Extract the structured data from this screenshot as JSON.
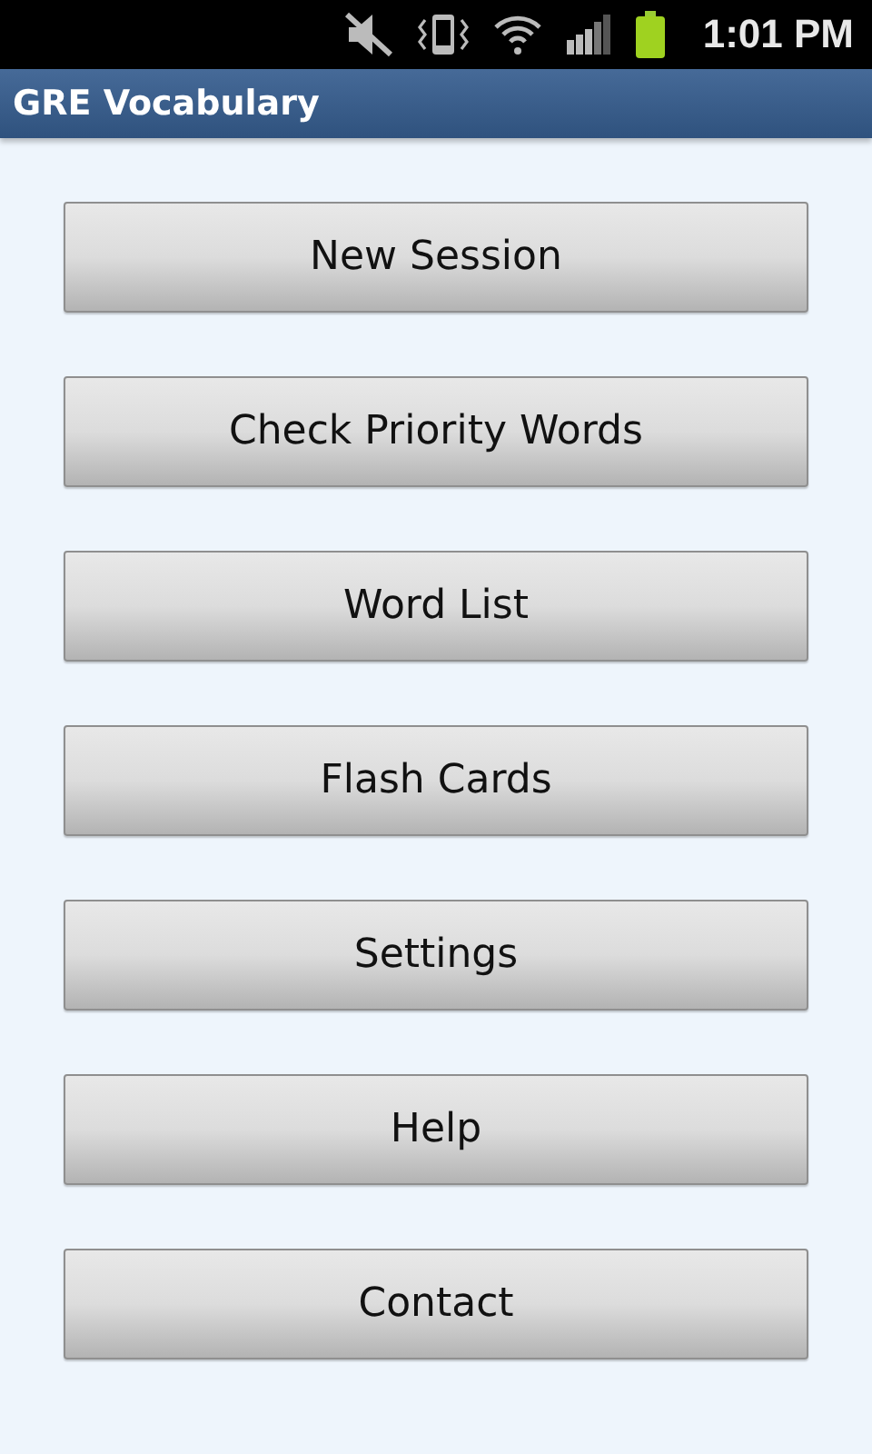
{
  "status_bar": {
    "time": "1:01 PM"
  },
  "title_bar": {
    "title": "GRE Vocabulary"
  },
  "menu_buttons": [
    {
      "label": "New Session"
    },
    {
      "label": "Check Priority Words"
    },
    {
      "label": "Word List"
    },
    {
      "label": "Flash Cards"
    },
    {
      "label": "Settings"
    },
    {
      "label": "Help"
    },
    {
      "label": "Contact"
    }
  ]
}
